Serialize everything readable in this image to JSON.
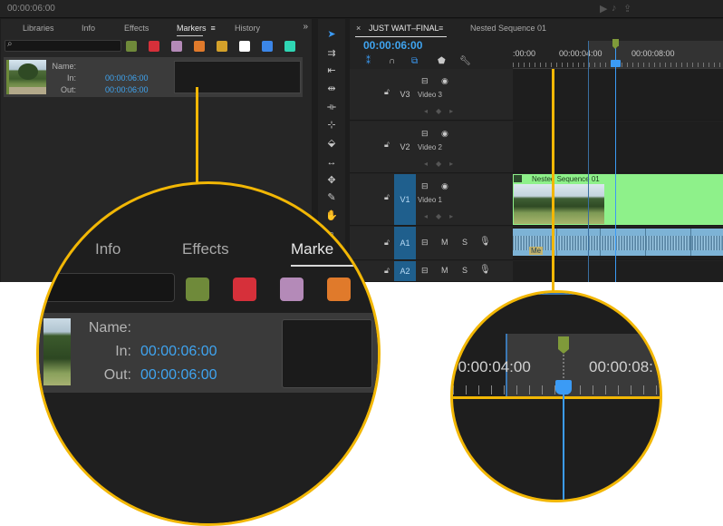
{
  "topbar": {
    "timecode": "00:00:06:00"
  },
  "markers_panel": {
    "tabs": [
      "Libraries",
      "Info",
      "Effects",
      "Markers",
      "History"
    ],
    "active_tab": "Markers",
    "more": "»",
    "swatches": [
      "#6f8a3a",
      "#d6303a",
      "#b48ab8",
      "#e07a2b",
      "#d4a12a",
      "#ffffff",
      "#3b86e8",
      "#2fd6b4"
    ],
    "marker": {
      "name_label": "Name:",
      "name": "",
      "in_label": "In:",
      "in": "00:00:06:00",
      "out_label": "Out:",
      "out": "00:00:06:00"
    }
  },
  "timeline": {
    "tabs": [
      "JUST WAIT–FINAL",
      "Nested Sequence 01"
    ],
    "active_tab": "JUST WAIT–FINAL",
    "timecode": "00:00:06:00",
    "ruler_labels": [
      ":00:00",
      "00:00:04:00",
      "00:00:08:00"
    ],
    "tracks": [
      {
        "id": "V3",
        "name": "Video 3"
      },
      {
        "id": "V2",
        "name": "Video 2"
      },
      {
        "id": "V1",
        "name": "Video 1"
      },
      {
        "id": "A1",
        "name": ""
      },
      {
        "id": "A2",
        "name": ""
      }
    ],
    "clip_title": "Nested Sequence 01",
    "audio_tag": "Me",
    "mute": "M",
    "solo": "S"
  },
  "zoom_left": {
    "tabs": [
      "Info",
      "Effects",
      "Marke"
    ],
    "swatches": [
      "#6f8a3a",
      "#d6303a",
      "#b48ab8",
      "#e07a2b"
    ],
    "name_label": "Name:",
    "in_label": "In:",
    "in": "00:00:06:00",
    "out_label": "Out:",
    "out": "00:00:06:00"
  },
  "zoom_right": {
    "labels": [
      "00:00:04:00",
      "00:00:08:"
    ]
  },
  "colors": {
    "accent_blue": "#3fa4f0",
    "callout_yellow": "#f2b705",
    "clip_green": "#8ef18a",
    "audio_blue": "#7db3d6"
  }
}
